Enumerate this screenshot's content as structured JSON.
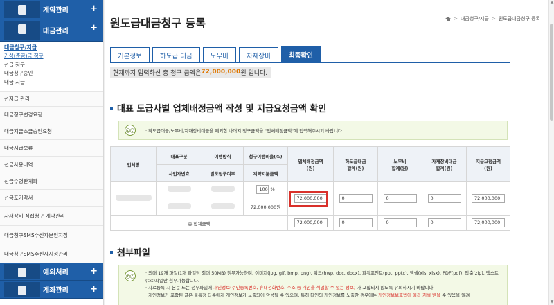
{
  "sidebar": {
    "contract_section": "계약관리",
    "payment_section": "대금관리",
    "payment_sub_active": "대금청구/지급",
    "payment_sub_items": [
      "기성(준공)금 청구",
      "선급 청구",
      "대금청구승인",
      "대금 지급"
    ],
    "menu_items": [
      "선지급 관리",
      "대금청구변경요청",
      "대금지급소급승인요청",
      "대금지급보류",
      "선금사용내역",
      "선금수령완계좌",
      "선금포기각서",
      "자재장비 직접청구 계약관리",
      "대금청구SMS수신자본인지정",
      "대금청구SMS수신자지정관리"
    ],
    "exception_section": "예외처리",
    "contract_mgmt_section": "계좌관리",
    "plus": "+"
  },
  "header": {
    "title": "원도급대금청구 등록",
    "breadcrumb": [
      "대금청구/지급",
      "원도급대금청구 등록"
    ],
    "sep": ">"
  },
  "tabs": [
    "기본정보",
    "하도급 대금",
    "노무비",
    "자재장비",
    "최종확인"
  ],
  "active_tab_index": 4,
  "total": {
    "prefix": "현재까지 입력하신 총 청구 금액은 ",
    "amount": "72,000,000",
    "suffix": "원 입니다."
  },
  "section1": {
    "title": "대표 도급사별 업체배정금액 작성 및 지급요청금액 확인",
    "notice_icon": "ⓒⓒ",
    "notice": "하도급대금/노무비/자재장비대금을 제외한 나머지 청구금액을 \"업체배정금액\"에 입력해주시기 바랍니다."
  },
  "table": {
    "h_company": "업체명",
    "h_rep_div": "대표구분",
    "h_biz_no": "사업자번호",
    "h_method": "이행방식",
    "h_separate": "별도청구여부",
    "h_ratio": "청구이행비율",
    "h_ratio_unit": "(%)",
    "h_contract_amt": "계약지분금액",
    "h_assign": "업체배정금액",
    "h_assign_unit": "(원)",
    "h_sub": "하도급대금",
    "h_sub_unit": "합계(원)",
    "h_labor": "노무비",
    "h_labor_unit": "합계(원)",
    "h_material": "자재장비대금",
    "h_material_unit": "합계(원)",
    "h_pay": "지급요청금액",
    "h_pay_unit": "(원)",
    "ratio_value": "100",
    "ratio_pct": "%",
    "contract_amount": "72,000,000원",
    "assign_value": "72,000,000",
    "sub_value": "0",
    "labor_value": "0",
    "material_value": "0",
    "pay_value": "72,000,000",
    "total_label": "총 합계금액",
    "total_assign": "72,000,000",
    "total_sub": "0",
    "total_labor": "0",
    "total_material": "0",
    "total_pay": "72,000,000"
  },
  "section2": {
    "title": "첨부파일",
    "notice_icon": "ⓒⓒ",
    "line1": "최대 19개 파일(1개 파일당 최대 50MB) 첨부가능하며, 이미지(jpg, gif, bmp, png), 워드(hwp, doc, docx), 파워포인트(ppt, pptx), 엑셀(xls, xlsx), PDF(pdf), 압축(zip), 텍스트(txt)파일만 첨부가능합니다.",
    "line2_a": "자료등록 시 본문 또는 첨부파일에 ",
    "line2_red": "개인정보(주민등록번호, 휴대전화번호, 주소 등 개인을 식별할 수 있는 정보)",
    "line2_b": " 가 포함되지 않도록 유의하시기 바랍니다.",
    "line3_a": "개인정보가 포함된 글은 불특정 다수에게 개인정보가 노출되어 악용될 수 있으며, 특히 타인의 개인정보를 노출한 경우에는 ",
    "line3_red": "개인정보보호법에 따라 처벌 받을",
    "line3_b": " 수 있음을 알려"
  }
}
